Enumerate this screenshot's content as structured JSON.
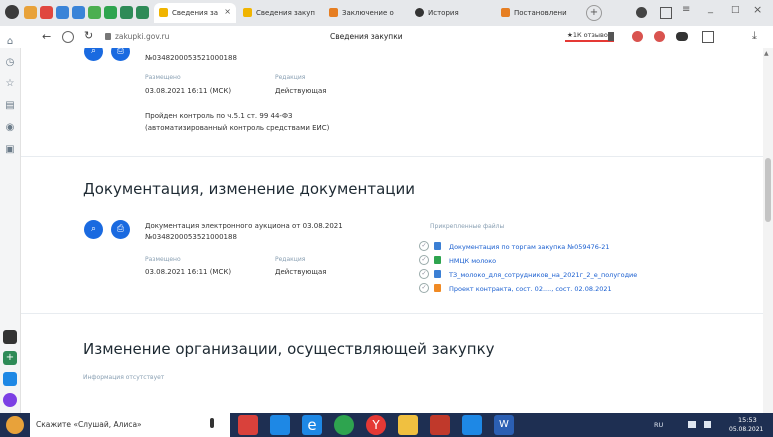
{
  "tabs": [
    {
      "label": "Сведения за",
      "active": true
    },
    {
      "label": "Сведения закуп",
      "active": false
    },
    {
      "label": "Заключение о",
      "active": false
    },
    {
      "label": "История",
      "active": false
    },
    {
      "label": "Постановлени",
      "active": false
    }
  ],
  "window_controls": {
    "minimize": "_",
    "maximize": "□",
    "close": "×"
  },
  "address": {
    "url": "zakupki.gov.ru",
    "page_title": "Сведения закупки",
    "reviews_badge": "★1К отзывов"
  },
  "notice_top": {
    "number": "№0348200053521000188",
    "posted_label": "Размещено",
    "posted_value": "03.08.2021 16:11 (МСК)",
    "edition_label": "Редакция",
    "edition_value": "Действующая",
    "control_line1": "Пройден контроль по ч.5.1 ст. 99 44-ФЗ",
    "control_line2": "(автоматизированный контроль средствами ЕИС)"
  },
  "section_docs": {
    "title": "Документация, изменение документации",
    "doc_title": "Документация электронного аукциона от 03.08.2021",
    "number": "№0348200053521000188",
    "posted_label": "Размещено",
    "posted_value": "03.08.2021 16:11 (МСК)",
    "edition_label": "Редакция",
    "edition_value": "Действующая",
    "files_label": "Прикрепленные файлы",
    "files": [
      {
        "name": "Документация по торгам закупка №059476-21",
        "color": "#3b7fd4"
      },
      {
        "name": "НМЦК молоко",
        "color": "#2ea44f"
      },
      {
        "name": "ТЗ_молоко_для_сотрудников_на_2021г_2_е_полугодие",
        "color": "#3b7fd4"
      },
      {
        "name": "Проект контракта, сост. 02...., сост. 02.08.2021",
        "color": "#f08a24"
      }
    ]
  },
  "section_org": {
    "title": "Изменение организации, осуществляющей закупку",
    "empty_text": "Информация отсутствует"
  },
  "taskbar": {
    "search_text": "Скажите «Слушай, Алиса»",
    "tray_lang": "RU",
    "time": "15:53",
    "date": "05.08.2021"
  }
}
